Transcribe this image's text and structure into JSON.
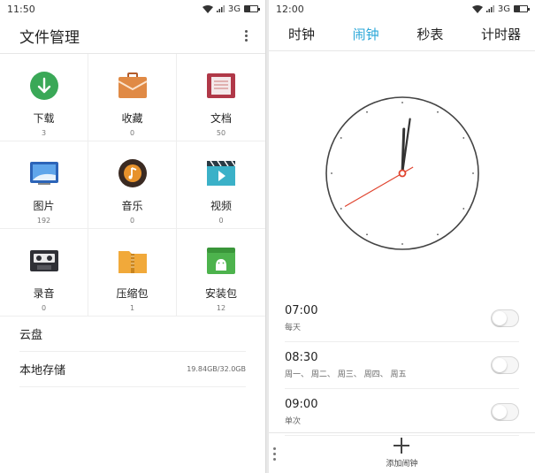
{
  "left": {
    "status_time": "11:50",
    "network": "3G",
    "title": "文件管理",
    "categories": [
      {
        "label": "下载",
        "count": "3",
        "icon": "download-icon"
      },
      {
        "label": "收藏",
        "count": "0",
        "icon": "briefcase-icon"
      },
      {
        "label": "文档",
        "count": "50",
        "icon": "document-icon"
      },
      {
        "label": "图片",
        "count": "192",
        "icon": "picture-icon"
      },
      {
        "label": "音乐",
        "count": "0",
        "icon": "music-disc-icon"
      },
      {
        "label": "视频",
        "count": "0",
        "icon": "clapperboard-icon"
      },
      {
        "label": "录音",
        "count": "0",
        "icon": "cassette-icon"
      },
      {
        "label": "压缩包",
        "count": "1",
        "icon": "zip-folder-icon"
      },
      {
        "label": "安装包",
        "count": "12",
        "icon": "android-package-icon"
      }
    ],
    "cloud_label": "云盘",
    "storage_label": "本地存储",
    "storage_value": "19.84GB/32.0GB"
  },
  "right": {
    "status_time": "12:00",
    "network": "3G",
    "tabs": [
      {
        "label": "时钟",
        "active": false
      },
      {
        "label": "闹钟",
        "active": true
      },
      {
        "label": "秒表",
        "active": false
      },
      {
        "label": "计时器",
        "active": false
      }
    ],
    "clock": {
      "hour": 12,
      "minute": 0,
      "second": 40
    },
    "alarms": [
      {
        "time": "07:00",
        "days": "每天",
        "enabled": false
      },
      {
        "time": "08:30",
        "days": "周一、 周二、 周三、 周四、 周五",
        "enabled": false
      },
      {
        "time": "09:00",
        "days": "单次",
        "enabled": false
      }
    ],
    "add_label": "添加闹钟"
  },
  "colors": {
    "accent": "#2aa7d8",
    "second_hand": "#e0442f"
  }
}
